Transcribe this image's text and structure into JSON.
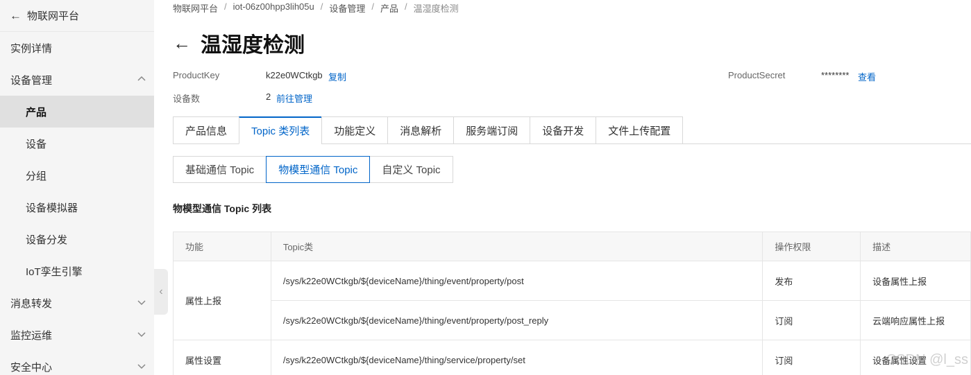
{
  "sidebar": {
    "header": "物联网平台",
    "items": [
      {
        "label": "实例详情"
      },
      {
        "label": "设备管理"
      },
      {
        "label": "产品"
      },
      {
        "label": "设备"
      },
      {
        "label": "分组"
      },
      {
        "label": "设备模拟器"
      },
      {
        "label": "设备分发"
      },
      {
        "label": "IoT孪生引擎"
      },
      {
        "label": "消息转发"
      },
      {
        "label": "监控运维"
      },
      {
        "label": "安全中心"
      }
    ]
  },
  "breadcrumb": [
    "物联网平台",
    "iot-06z00hpp3lih05u",
    "设备管理",
    "产品",
    "温湿度检测"
  ],
  "page": {
    "title": "温湿度检测",
    "product_key_label": "ProductKey",
    "product_key_value": "k22e0WCtkgb",
    "product_key_action": "复制",
    "device_count_label": "设备数",
    "device_count_value": "2",
    "device_count_action": "前往管理",
    "product_secret_label": "ProductSecret",
    "product_secret_value": "********",
    "product_secret_action": "查看"
  },
  "tabs": [
    "产品信息",
    "Topic 类列表",
    "功能定义",
    "消息解析",
    "服务端订阅",
    "设备开发",
    "文件上传配置"
  ],
  "subtabs": [
    "基础通信 Topic",
    "物模型通信 Topic",
    "自定义 Topic"
  ],
  "section_title": "物模型通信 Topic 列表",
  "table": {
    "headers": [
      "功能",
      "Topic类",
      "操作权限",
      "描述"
    ],
    "groups": [
      {
        "func": "属性上报",
        "rows": [
          {
            "topic": "/sys/k22e0WCtkgb/${deviceName}/thing/event/property/post",
            "perm": "发布",
            "desc": "设备属性上报"
          },
          {
            "topic": "/sys/k22e0WCtkgb/${deviceName}/thing/event/property/post_reply",
            "perm": "订阅",
            "desc": "云端响应属性上报"
          }
        ]
      },
      {
        "func": "属性设置",
        "rows": [
          {
            "topic": "/sys/k22e0WCtkgb/${deviceName}/thing/service/property/set",
            "perm": "订阅",
            "desc": "设备属性设置"
          }
        ]
      }
    ]
  },
  "watermark": "CSDN @l_ss",
  "colors": {
    "accent": "#0064c8",
    "sidebar_bg": "#f5f5f5",
    "active_item_bg": "#e0e0e0"
  }
}
